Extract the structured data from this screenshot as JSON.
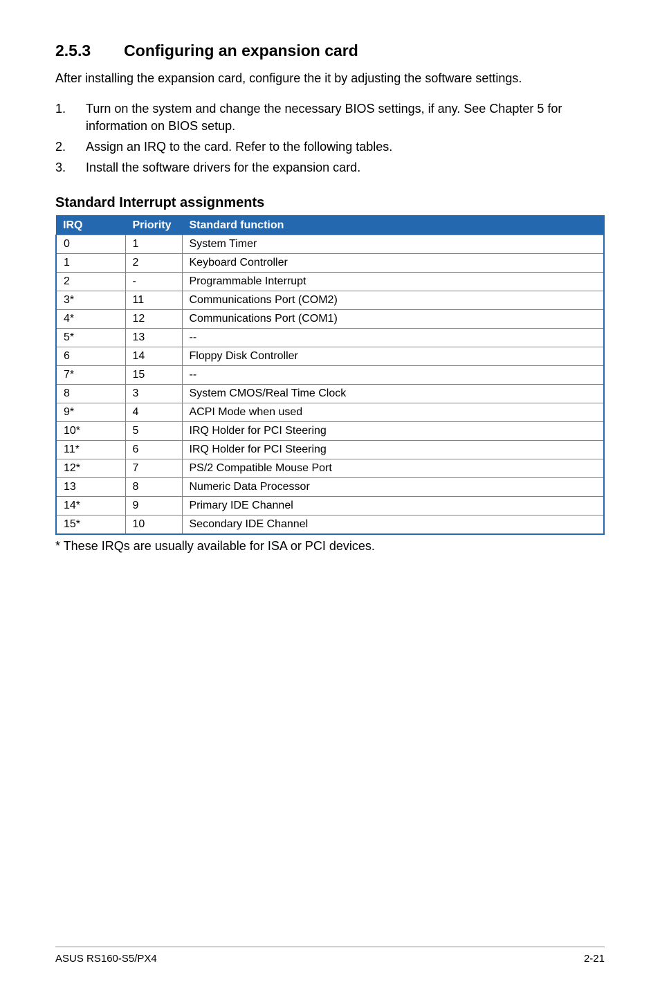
{
  "section": {
    "number": "2.5.3",
    "title": "Configuring an expansion card",
    "intro": "After installing the expansion card, configure the it by adjusting the software settings.",
    "steps": [
      {
        "num": "1.",
        "text": "Turn on the system and change the necessary BIOS settings, if any. See Chapter 5 for information on BIOS setup."
      },
      {
        "num": "2.",
        "text": "Assign an IRQ to the card. Refer to the following tables."
      },
      {
        "num": "3.",
        "text": "Install the software drivers for the expansion card."
      }
    ]
  },
  "table": {
    "heading": "Standard Interrupt assignments",
    "headers": [
      "IRQ",
      "Priority",
      "Standard function"
    ],
    "rows": [
      [
        "0",
        "1",
        "System Timer"
      ],
      [
        "1",
        "2",
        "Keyboard Controller"
      ],
      [
        "2",
        "-",
        "Programmable Interrupt"
      ],
      [
        "3*",
        "11",
        "Communications Port (COM2)"
      ],
      [
        "4*",
        "12",
        "Communications Port (COM1)"
      ],
      [
        "5*",
        "13",
        "--"
      ],
      [
        "6",
        "14",
        "Floppy Disk Controller"
      ],
      [
        "7*",
        "15",
        "--"
      ],
      [
        "8",
        "3",
        "System CMOS/Real Time Clock"
      ],
      [
        "9*",
        "4",
        "ACPI Mode when used"
      ],
      [
        "10*",
        "5",
        "IRQ Holder for PCI Steering"
      ],
      [
        "11*",
        "6",
        "IRQ Holder for PCI Steering"
      ],
      [
        "12*",
        "7",
        "PS/2 Compatible Mouse Port"
      ],
      [
        "13",
        "8",
        "Numeric Data Processor"
      ],
      [
        "14*",
        "9",
        "Primary IDE Channel"
      ],
      [
        "15*",
        "10",
        "Secondary IDE Channel"
      ]
    ],
    "footnote": "* These IRQs are usually available for ISA or PCI devices."
  },
  "footer": {
    "left": "ASUS RS160-S5/PX4",
    "right": "2-21"
  }
}
